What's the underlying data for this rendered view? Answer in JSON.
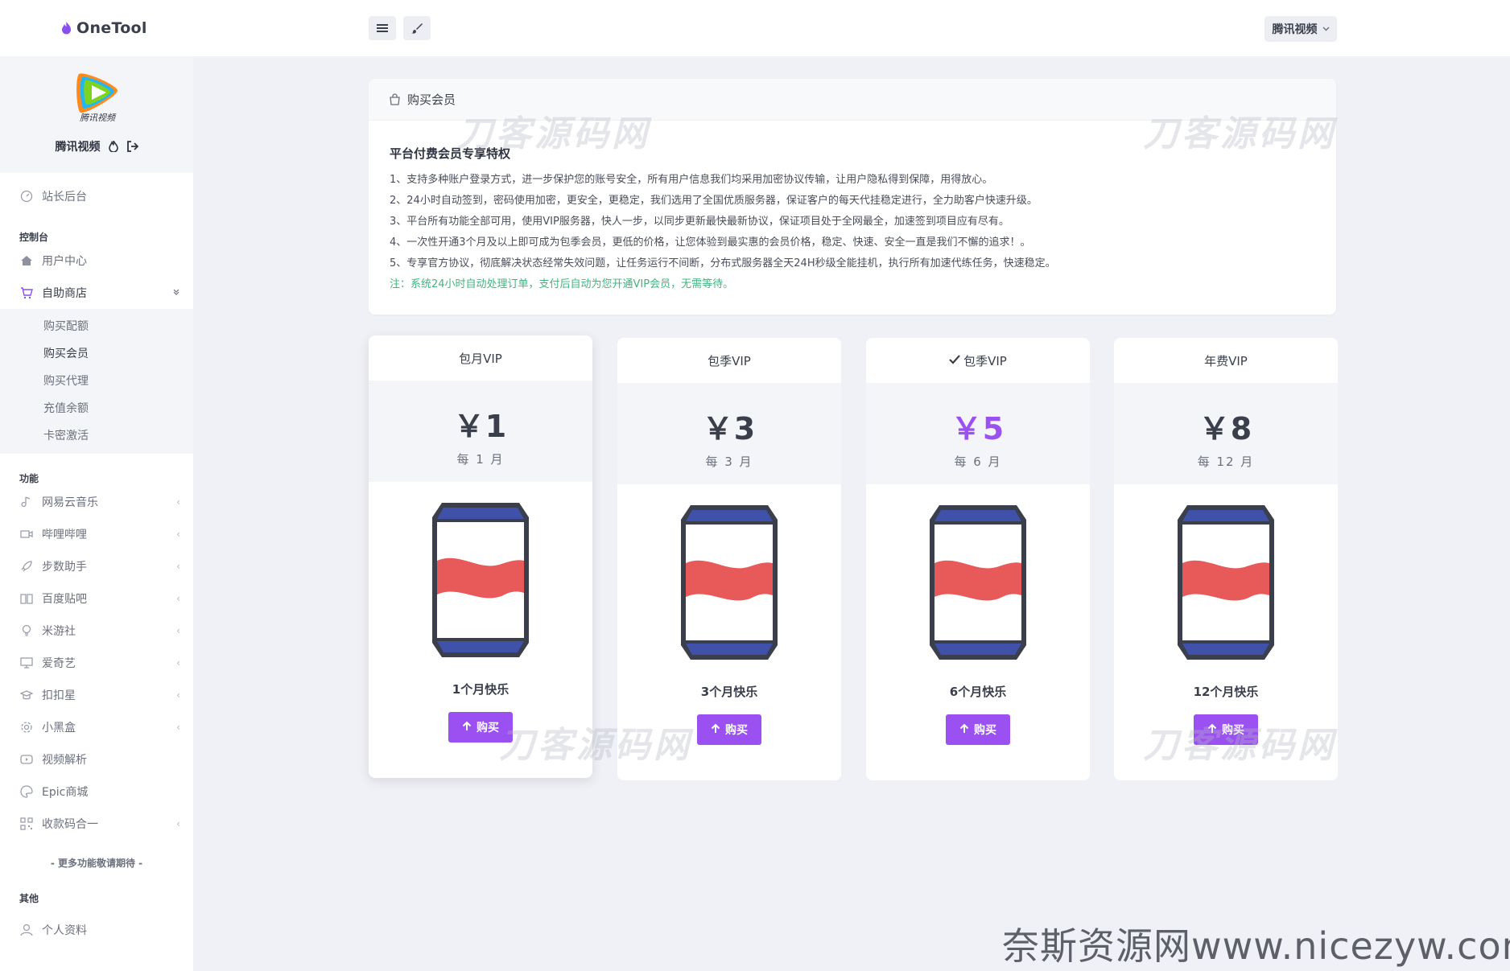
{
  "app": {
    "brand": "OneTool",
    "site_selector": "腾讯视频"
  },
  "profile": {
    "name": "腾讯视频",
    "logo_caption": "腾讯视频"
  },
  "sidebar": {
    "admin": "站长后台",
    "section_console": "控制台",
    "user_center": "用户中心",
    "shop": "自助商店",
    "shop_sub": [
      "购买配额",
      "购买会员",
      "购买代理",
      "充值余额",
      "卡密激活"
    ],
    "section_features": "功能",
    "features": [
      {
        "label": "网易云音乐",
        "icon": "music-note-icon",
        "has_arrow": true
      },
      {
        "label": "哔哩哔哩",
        "icon": "video-camera-icon",
        "has_arrow": true
      },
      {
        "label": "步数助手",
        "icon": "rocket-icon",
        "has_arrow": true
      },
      {
        "label": "百度贴吧",
        "icon": "book-icon",
        "has_arrow": true
      },
      {
        "label": "米游社",
        "icon": "lightbulb-icon",
        "has_arrow": true
      },
      {
        "label": "爱奇艺",
        "icon": "monitor-icon",
        "has_arrow": true
      },
      {
        "label": "扣扣星",
        "icon": "graduation-cap-icon",
        "has_arrow": true
      },
      {
        "label": "小黑盒",
        "icon": "gear-icon",
        "has_arrow": true
      },
      {
        "label": "视频解析",
        "icon": "play-circle-icon",
        "has_arrow": false
      },
      {
        "label": "Epic商城",
        "icon": "palette-icon",
        "has_arrow": false
      },
      {
        "label": "收款码合一",
        "icon": "qrcode-icon",
        "has_arrow": true
      }
    ],
    "more_text": "- 更多功能敬请期待 -",
    "section_other": "其他",
    "profile_link": "个人资料"
  },
  "notice": {
    "header": "购买会员",
    "title": "平台付费会员专享特权",
    "lines": [
      "1、支持多种账户登录方式，进一步保护您的账号安全，所有用户信息我们均采用加密协议传输，让用户隐私得到保障，用得放心。",
      "2、24小时自动签到，密码使用加密，更安全，更稳定，我们选用了全国优质服务器，保证客户的每天代挂稳定进行，全力助客户快速升级。",
      "3、平台所有功能全部可用，使用VIP服务器，快人一步，以同步更新最快最新协议，保证项目处于全网最全，加速签到项目应有尽有。",
      "4、一次性开通3个月及以上即可成为包季会员，更低的价格，让您体验到最实惠的会员价格，稳定、快速、安全一直是我们不懈的追求！。",
      "5、专享官方协议，彻底解决状态经常失效问题，让任务运行不间断，分布式服务器全天24H秒级全能挂机，执行所有加速代练任务，快速稳定。"
    ],
    "note": "注：系统24小时自动处理订单，支付后自动为您开通VIP会员，无需等待。"
  },
  "plans": [
    {
      "name": "包月VIP",
      "price": "￥1",
      "period": "每 1 月",
      "label": "1个月快乐",
      "button": "购买",
      "checked": false,
      "highlight": false
    },
    {
      "name": "包季VIP",
      "price": "￥3",
      "period": "每 3 月",
      "label": "3个月快乐",
      "button": "购买",
      "checked": false,
      "highlight": false
    },
    {
      "name": "包季VIP",
      "price": "￥5",
      "period": "每 6 月",
      "label": "6个月快乐",
      "button": "购买",
      "checked": true,
      "highlight": true
    },
    {
      "name": "年费VIP",
      "price": "￥8",
      "period": "每 12 月",
      "label": "12个月快乐",
      "button": "购买",
      "checked": false,
      "highlight": false
    }
  ],
  "watermarks": {
    "brand": "刀客源码网",
    "footer": "奈斯资源网www.nicezyw.com"
  },
  "colors": {
    "accent": "#9b51f2",
    "note_green": "#40b47f",
    "can_blue": "#3f51a8",
    "can_red": "#e85a5a",
    "can_outline": "#3a3f4b"
  }
}
